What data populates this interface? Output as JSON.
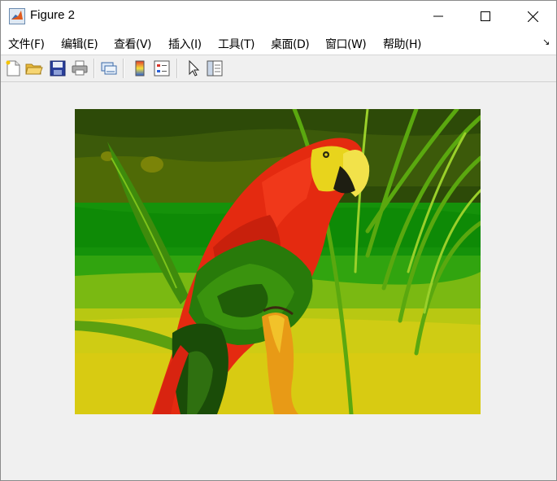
{
  "window": {
    "title": "Figure 2"
  },
  "menubar": {
    "items": [
      {
        "label": "文件(F)"
      },
      {
        "label": "编辑(E)"
      },
      {
        "label": "查看(V)"
      },
      {
        "label": "插入(I)"
      },
      {
        "label": "工具(T)"
      },
      {
        "label": "桌面(D)"
      },
      {
        "label": "窗口(W)"
      },
      {
        "label": "帮助(H)"
      }
    ]
  },
  "toolbar": {
    "buttons": [
      {
        "icon": "new-file-icon"
      },
      {
        "icon": "open-folder-icon"
      },
      {
        "icon": "save-icon"
      },
      {
        "icon": "print-icon"
      },
      {
        "icon": "link-plot-icon"
      },
      {
        "icon": "colorbar-icon"
      },
      {
        "icon": "legend-icon"
      },
      {
        "icon": "pointer-icon"
      },
      {
        "icon": "property-inspector-icon"
      }
    ]
  },
  "figure": {
    "image": "parrot-posterized-icon",
    "colors": {
      "red": "#e52a12",
      "yellow": "#e5d21a",
      "green": "#1f9a12",
      "dark_green": "#2f4e0a",
      "olive": "#6a6e08"
    }
  }
}
